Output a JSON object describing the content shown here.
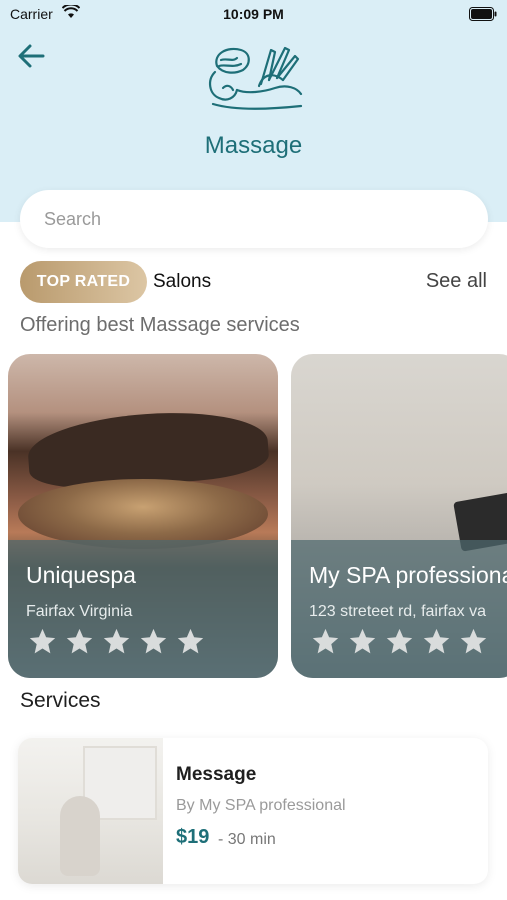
{
  "status_bar": {
    "carrier": "Carrier",
    "time": "10:09 PM"
  },
  "header": {
    "title": "Massage",
    "hero_icon": "massage-icon",
    "back_icon": "arrow-left-icon"
  },
  "search": {
    "placeholder": "Search"
  },
  "top_rated": {
    "badge": "TOP RATED",
    "label": "Salons",
    "see_all": "See all",
    "subtitle": "Offering best Massage services"
  },
  "salons": [
    {
      "name": "Uniquespa",
      "location": "Fairfax Virginia",
      "rating": 0,
      "max_rating": 5
    },
    {
      "name": "My SPA professional",
      "location": "123 streteet rd, fairfax va",
      "rating": 0,
      "max_rating": 5
    }
  ],
  "services": {
    "title": "Services",
    "items": [
      {
        "name": "Message",
        "by": "By My SPA professional",
        "price": "$19",
        "duration": "- 30 min"
      }
    ]
  },
  "colors": {
    "accent": "#1e6f78",
    "header_bg": "#daeef6",
    "badge": "#c9ad84"
  }
}
